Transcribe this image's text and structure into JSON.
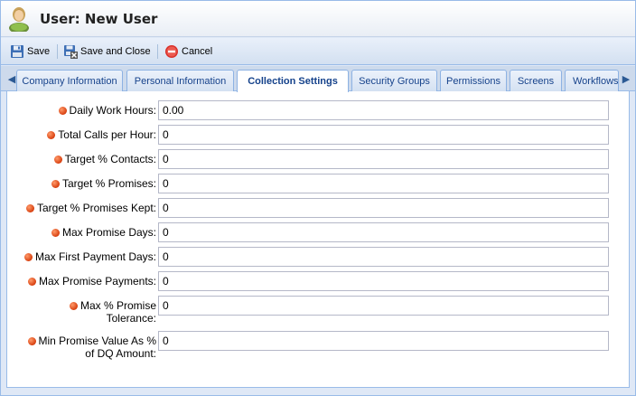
{
  "window": {
    "title": "User: New User"
  },
  "toolbar": {
    "save_label": "Save",
    "save_close_label": "Save and Close",
    "cancel_label": "Cancel"
  },
  "tabs": [
    {
      "label": "Company Information",
      "active": false
    },
    {
      "label": "Personal Information",
      "active": false
    },
    {
      "label": "Collection Settings",
      "active": true
    },
    {
      "label": "Security Groups",
      "active": false
    },
    {
      "label": "Permissions",
      "active": false
    },
    {
      "label": "Screens",
      "active": false
    },
    {
      "label": "Workflows",
      "active": false
    }
  ],
  "form": {
    "fields": [
      {
        "label": "Daily Work Hours:",
        "value": "0.00"
      },
      {
        "label": "Total Calls per Hour:",
        "value": "0"
      },
      {
        "label": "Target % Contacts:",
        "value": "0"
      },
      {
        "label": "Target % Promises:",
        "value": "0"
      },
      {
        "label": "Target % Promises Kept:",
        "value": "0"
      },
      {
        "label": "Max Promise Days:",
        "value": "0"
      },
      {
        "label": "Max First Payment Days:",
        "value": "0"
      },
      {
        "label": "Max Promise Payments:",
        "value": "0"
      },
      {
        "label_line1": "Max % Promise",
        "label_line2": "Tolerance:",
        "value": "0"
      },
      {
        "label_line1": "Min Promise Value As %",
        "label_line2": "of DQ Amount:",
        "value": "0"
      }
    ]
  },
  "colors": {
    "required_dot": "#d8400f",
    "tab_text": "#15428b",
    "border": "#99bbe8"
  }
}
